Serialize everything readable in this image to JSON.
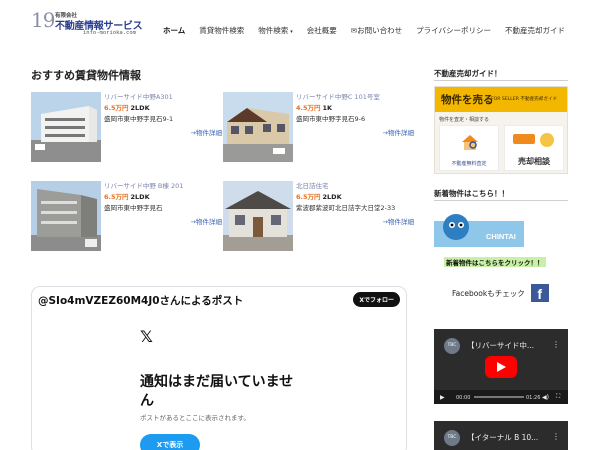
{
  "logo": {
    "number": "19",
    "company_type": "有限会社",
    "name": "不動産情報サービス",
    "url": "info-morioka.com"
  },
  "nav": [
    {
      "label": "ホーム",
      "active": true
    },
    {
      "label": "賃貸物件検索"
    },
    {
      "label": "物件検索",
      "caret": "▾"
    },
    {
      "label": "会社概要"
    },
    {
      "label": "✉お問い合わせ"
    },
    {
      "label": "プライバシーポリシー"
    },
    {
      "label": "不動産売却ガイド"
    }
  ],
  "main": {
    "section_title": "おすすめ賃貸物件情報",
    "properties": [
      {
        "name": "リバーサイド中野A301",
        "price": "6.5万円",
        "layout": "2LDK",
        "address": "盛岡市東中野字見石9-1",
        "detail": "→物件詳細"
      },
      {
        "name": "リバーサイド中野C 101号室",
        "price": "4.5万円",
        "layout": "1K",
        "address": "盛岡市東中野字見石9-6",
        "detail": "→物件詳細"
      },
      {
        "name": "リバーサイド中野 B棟 201",
        "price": "6.5万円",
        "layout": "2LDK",
        "address": "盛岡市東中野字見石",
        "detail": "→物件詳細"
      },
      {
        "name": "北日詰住宅",
        "price": "6.5万円",
        "layout": "2LDK",
        "address": "紫波郡紫波町北日詰字大日堂2-33",
        "detail": "→物件詳細"
      }
    ]
  },
  "xembed": {
    "header": "@SIo4mVZEZ60M4J0さんによるポスト",
    "follow": "Xでフォロー",
    "logo": "𝕏",
    "notice": "通知はまだ届いていません",
    "sub": "ポストがあるとここに表示されます。",
    "view": "Xで表示"
  },
  "sidebar": {
    "guide_title": "不動産売却ガイド！",
    "guide": {
      "big": "物件を売る",
      "small": "FOR SELLER 不動産売却ガイド",
      "line": "物件を査定・相談する",
      "card1": "不動産無料査定",
      "card2": "売却相談"
    },
    "new_title": "新着物件はこちら！！",
    "chintai_text": "CHINTAI",
    "new_link": "新着物件はこちらをクリック！！",
    "facebook": "Facebookもチェック",
    "videos": [
      {
        "title": "【リバーサイド中...",
        "time_start": "00:00",
        "time_end": "01:26"
      },
      {
        "title": "【イターナル B 10..."
      }
    ]
  }
}
